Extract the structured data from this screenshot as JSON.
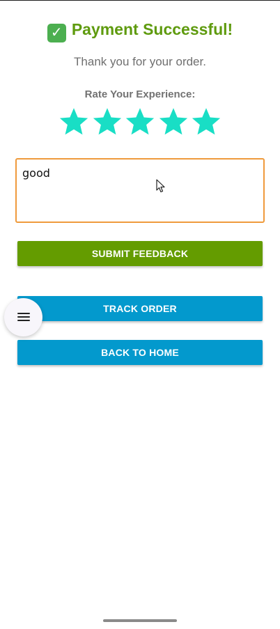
{
  "header": {
    "title": "Payment Successful!",
    "title_icon": "check-mark-button-icon",
    "subtitle": "Thank you for your order."
  },
  "rating": {
    "label": "Rate Your Experience:",
    "value": 5,
    "max": 5,
    "star_color": "#19dec5"
  },
  "feedback": {
    "value": "good"
  },
  "buttons": {
    "submit": "SUBMIT FEEDBACK",
    "track": "TRACK ORDER",
    "home": "BACK TO HOME"
  },
  "colors": {
    "success": "#5f9b0f",
    "submit_button": "#649c00",
    "primary_button": "#0399cd",
    "input_border": "#ef9a3c"
  },
  "fab": {
    "icon": "menu-icon"
  }
}
